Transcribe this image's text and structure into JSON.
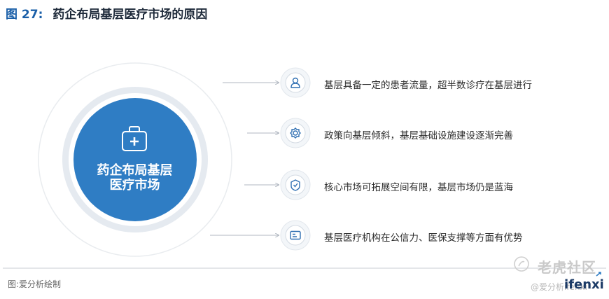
{
  "figure": {
    "number": "图 27:",
    "title": "药企布局基层医疗市场的原因"
  },
  "center": {
    "label": "药企布局基层医疗市场"
  },
  "reasons": [
    {
      "text": "基层具备一定的患者流量，超半数诊疗在基层进行",
      "icon": "doctor-icon"
    },
    {
      "text": "政策向基层倾斜，基层基础设施建设逐渐完善",
      "icon": "gear-icon"
    },
    {
      "text": "核心市场可拓展空间有限，基层市场仍是蓝海",
      "icon": "shield-icon"
    },
    {
      "text": "基层医疗机构在公信力、医保支撑等方面有优势",
      "icon": "card-icon"
    }
  ],
  "source": "图:爱分析绘制",
  "watermark": {
    "text": "老虎社区",
    "handle": "@爱分析ifenxi"
  },
  "brand": "ifenxi",
  "colors": {
    "primary_blue": "#2f7dc4",
    "title_blue": "#1a5fa8",
    "ring_gray": "#e6ebf1",
    "icon_blue": "#2f6fb2"
  }
}
